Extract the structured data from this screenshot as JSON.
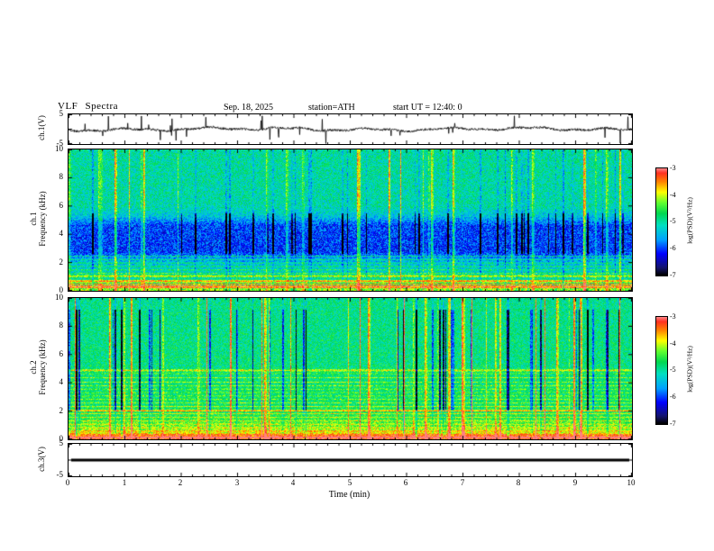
{
  "header": {
    "title": "VLF  Spectra",
    "date": "Sep. 18, 2025",
    "station": "station=ATH",
    "start_ut": "start UT =  12:40: 0"
  },
  "axes": {
    "time_label": "Time (min)",
    "time_ticks": [
      "0",
      "1",
      "2",
      "3",
      "4",
      "5",
      "6",
      "7",
      "8",
      "9",
      "10"
    ],
    "freq_ticks_desc": [
      "10",
      "8",
      "6",
      "4",
      "2",
      "0"
    ],
    "volt_top": "5",
    "volt_bottom": "-5",
    "ch1_volt_label": "ch.1(V)",
    "ch3_volt_label": "ch.3(V)",
    "ch1_spec_label_line1": "ch.1",
    "ch2_spec_label_line1": "ch.2",
    "spec_label_line2": "Frequency (kHz)"
  },
  "colorbar": {
    "label": "log(PSD)(V²/Hz)",
    "ticks": [
      "-3",
      "-4",
      "-5",
      "-6",
      "-7"
    ],
    "range": [
      -7,
      -3
    ],
    "colormap_stops": [
      [
        0,
        "#000000"
      ],
      [
        0.07,
        "#14146e"
      ],
      [
        0.2,
        "#0000ff"
      ],
      [
        0.33,
        "#00a0ff"
      ],
      [
        0.47,
        "#00e0c0"
      ],
      [
        0.58,
        "#00d850"
      ],
      [
        0.68,
        "#60ff30"
      ],
      [
        0.78,
        "#ffff00"
      ],
      [
        0.88,
        "#ff8000"
      ],
      [
        0.96,
        "#ff3020"
      ],
      [
        1,
        "#ff8080"
      ]
    ]
  },
  "chart_data": [
    {
      "type": "line",
      "name": "ch1-voltage-waveform",
      "ylabel": "ch.1(V)",
      "xlabel": "Time (min)",
      "xlim": [
        0,
        10
      ],
      "ylim": [
        -5,
        5
      ],
      "yticks": [
        5,
        -5
      ],
      "line_color": "#000000",
      "summary": "Noisy ch.1 voltage trace fluctuating around 0 V with slow wander of about ±1 V and frequent impulsive spikes reaching about ±5 V over the full 10 minutes",
      "n_points": 1400,
      "seed": 11,
      "noise_amp": 0.38,
      "wander_amp": 0.7,
      "spike_prob": 0.02,
      "spike_max": 4.8
    },
    {
      "type": "heatmap",
      "name": "ch1-spectrogram",
      "ylabel": "ch.1 Frequency (kHz)",
      "xlim": [
        0,
        10
      ],
      "ylim": [
        0,
        10
      ],
      "yticks": [
        0,
        2,
        4,
        6,
        8,
        10
      ],
      "value_range": [
        -7,
        -3
      ],
      "colormap": "jet-like (black-blue-cyan-green-yellow-red)",
      "summary": "Green broadband background (~-5) above ~5.5 kHz, dark blue quiet band ~2.6-5.5 kHz (~-6), bright banded structure with yellow/red horizontal harmonic lines below ~2.5 kHz, frequent vertical bright sferic columns and dark dropout columns",
      "seed": 7,
      "base_profile": [
        [
          0,
          -4.25
        ],
        [
          0.2,
          -4.1
        ],
        [
          0.5,
          -4.55
        ],
        [
          1.0,
          -5.1
        ],
        [
          1.8,
          -5.35
        ],
        [
          2.3,
          -5.6
        ],
        [
          2.8,
          -6.05
        ],
        [
          4.6,
          -6.0
        ],
        [
          5.3,
          -5.35
        ],
        [
          6.0,
          -5.05
        ],
        [
          10,
          -5.0
        ]
      ],
      "line_freqs": [
        0.2,
        0.45,
        0.7,
        0.95,
        1.2,
        1.45,
        1.7,
        1.95,
        2.2,
        2.45
      ],
      "line_strength": 1.1,
      "strong_line_freqs": [
        0.3,
        0.62,
        1.05
      ],
      "strong_line_strength": 1.9,
      "bright_col_prob": 0.055,
      "dark_col_prob": 0.05,
      "dark_band": [
        2.6,
        5.5
      ],
      "noise_amp": 0.5
    },
    {
      "type": "heatmap",
      "name": "ch2-spectrogram",
      "ylabel": "ch.2 Frequency (kHz)",
      "xlim": [
        0,
        10
      ],
      "ylim": [
        0,
        10
      ],
      "yticks": [
        0,
        2,
        4,
        6,
        8,
        10
      ],
      "value_range": [
        -7,
        -3
      ],
      "colormap": "jet-like (black-blue-cyan-green-yellow-red)",
      "summary": "Green background (~-4.8) with many yellow horizontal harmonic lines between ~0.5 and 5 kHz, intense red band below ~0.4 kHz (~-3.3), vertical bright streaks and dark blue dropout columns above ~2 kHz",
      "seed": 23,
      "base_profile": [
        [
          0,
          -3.25
        ],
        [
          0.3,
          -3.3
        ],
        [
          0.42,
          -3.9
        ],
        [
          0.8,
          -4.25
        ],
        [
          1.5,
          -4.55
        ],
        [
          2.5,
          -4.75
        ],
        [
          6.0,
          -4.85
        ],
        [
          10,
          -4.9
        ]
      ],
      "line_freqs": [
        0.55,
        0.8,
        1.05,
        1.3,
        1.55,
        1.8,
        2.05,
        2.3,
        2.55,
        2.8,
        3.05,
        3.3,
        3.55,
        3.8,
        4.05,
        4.35,
        4.65,
        4.95
      ],
      "line_strength": 0.75,
      "strong_line_freqs": [
        0.1,
        2.0,
        4.85
      ],
      "strong_line_strength": 1.4,
      "bright_col_prob": 0.05,
      "dark_col_prob": 0.055,
      "dark_band": [
        2.0,
        9.2
      ],
      "noise_amp": 0.45
    },
    {
      "type": "line",
      "name": "ch3-voltage-flatline",
      "ylabel": "ch.3(V)",
      "xlim": [
        0,
        10
      ],
      "ylim": [
        -5,
        5
      ],
      "yticks": [
        5,
        -5
      ],
      "summary": "ch.3 voltage is a constant flat line at 0 V (thick black trace, no signal)",
      "flat_value": 0,
      "line_width": 3
    }
  ]
}
